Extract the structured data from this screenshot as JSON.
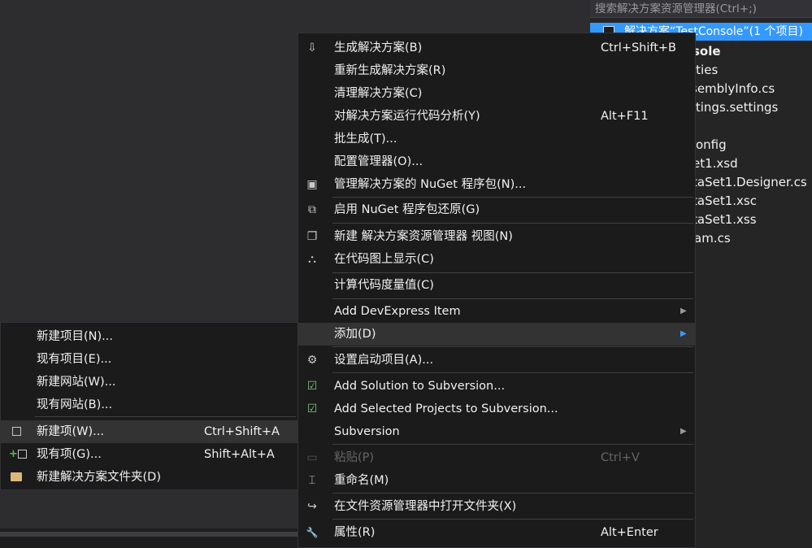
{
  "solution_explorer": {
    "search_placeholder": "搜索解决方案资源管理器(Ctrl+;)",
    "root_label": "解决方案“TestConsole”(1 个项目)",
    "items": [
      {
        "label": "sole",
        "bold": true
      },
      {
        "label": "rties",
        "bold": false
      },
      {
        "label": "semblyInfo.cs",
        "bold": false
      },
      {
        "label": "ttings.settings",
        "bold": false
      },
      {
        "label": "",
        "bold": false
      },
      {
        "label": "onfig",
        "bold": false
      },
      {
        "label": "et1.xsd",
        "bold": false
      },
      {
        "label": "taSet1.Designer.cs",
        "bold": false
      },
      {
        "label": "taSet1.xsc",
        "bold": false
      },
      {
        "label": "taSet1.xss",
        "bold": false
      },
      {
        "label": "am.cs",
        "bold": false
      }
    ]
  },
  "context_menu": {
    "items": [
      {
        "icon": "build-solution-icon",
        "glyph": "⇩",
        "label": "生成解决方案(B)",
        "shortcut": "Ctrl+Shift+B"
      },
      {
        "icon": "",
        "glyph": "",
        "label": "重新生成解决方案(R)",
        "shortcut": ""
      },
      {
        "icon": "",
        "glyph": "",
        "label": "清理解决方案(C)",
        "shortcut": ""
      },
      {
        "icon": "",
        "glyph": "",
        "label": "对解决方案运行代码分析(Y)",
        "shortcut": "Alt+F11"
      },
      {
        "icon": "",
        "glyph": "",
        "label": "批生成(T)...",
        "shortcut": ""
      },
      {
        "icon": "",
        "glyph": "",
        "label": "配置管理器(O)...",
        "shortcut": ""
      },
      {
        "icon": "nuget-package-icon",
        "glyph": "▣",
        "label": "管理解决方案的 NuGet 程序包(N)...",
        "shortcut": ""
      },
      {
        "icon": "nuget-restore-icon",
        "glyph": "⧉",
        "label": "启用 NuGet 程序包还原(G)",
        "shortcut": ""
      },
      {
        "icon": "new-view-icon",
        "glyph": "❐",
        "label": "新建 解决方案资源管理器 视图(N)",
        "shortcut": ""
      },
      {
        "icon": "code-map-icon",
        "glyph": "⛬",
        "label": "在代码图上显示(C)",
        "shortcut": ""
      },
      {
        "icon": "",
        "glyph": "",
        "label": "计算代码度量值(C)",
        "shortcut": ""
      },
      {
        "icon": "",
        "glyph": "",
        "label": "Add DevExpress Item",
        "shortcut": "",
        "submenu": true
      },
      {
        "icon": "",
        "glyph": "",
        "label": "添加(D)",
        "shortcut": "",
        "submenu": true,
        "highlighted": true
      },
      {
        "icon": "gear-icon",
        "glyph": "⚙",
        "label": "设置启动项目(A)...",
        "shortcut": ""
      },
      {
        "icon": "svn-add-icon",
        "glyph": "☑",
        "label": "Add Solution to Subversion...",
        "shortcut": ""
      },
      {
        "icon": "svn-add-selected-icon",
        "glyph": "☑",
        "label": "Add Selected Projects to Subversion...",
        "shortcut": ""
      },
      {
        "icon": "",
        "glyph": "",
        "label": "Subversion",
        "shortcut": "",
        "submenu": true
      },
      {
        "icon": "paste-icon",
        "glyph": "▭",
        "label": "粘贴(P)",
        "shortcut": "Ctrl+V",
        "disabled": true
      },
      {
        "icon": "rename-icon",
        "glyph": "⌶",
        "label": "重命名(M)",
        "shortcut": ""
      },
      {
        "icon": "open-folder-arrow-icon",
        "glyph": "↪",
        "label": "在文件资源管理器中打开文件夹(X)",
        "shortcut": ""
      },
      {
        "icon": "wrench-icon",
        "glyph": "🔧",
        "label": "属性(R)",
        "shortcut": "Alt+Enter"
      }
    ]
  },
  "add_submenu": {
    "items": [
      {
        "icon": "",
        "label": "新建项目(N)...",
        "shortcut": ""
      },
      {
        "icon": "",
        "label": "现有项目(E)...",
        "shortcut": ""
      },
      {
        "icon": "",
        "label": "新建网站(W)...",
        "shortcut": ""
      },
      {
        "icon": "",
        "label": "现有网站(B)...",
        "shortcut": ""
      },
      {
        "icon": "new-item-icon",
        "label": "新建项(W)...",
        "shortcut": "Ctrl+Shift+A",
        "highlighted": true
      },
      {
        "icon": "existing-item-icon",
        "label": "现有项(G)...",
        "shortcut": "Shift+Alt+A"
      },
      {
        "icon": "new-folder-icon",
        "label": "新建解决方案文件夹(D)",
        "shortcut": ""
      }
    ]
  }
}
